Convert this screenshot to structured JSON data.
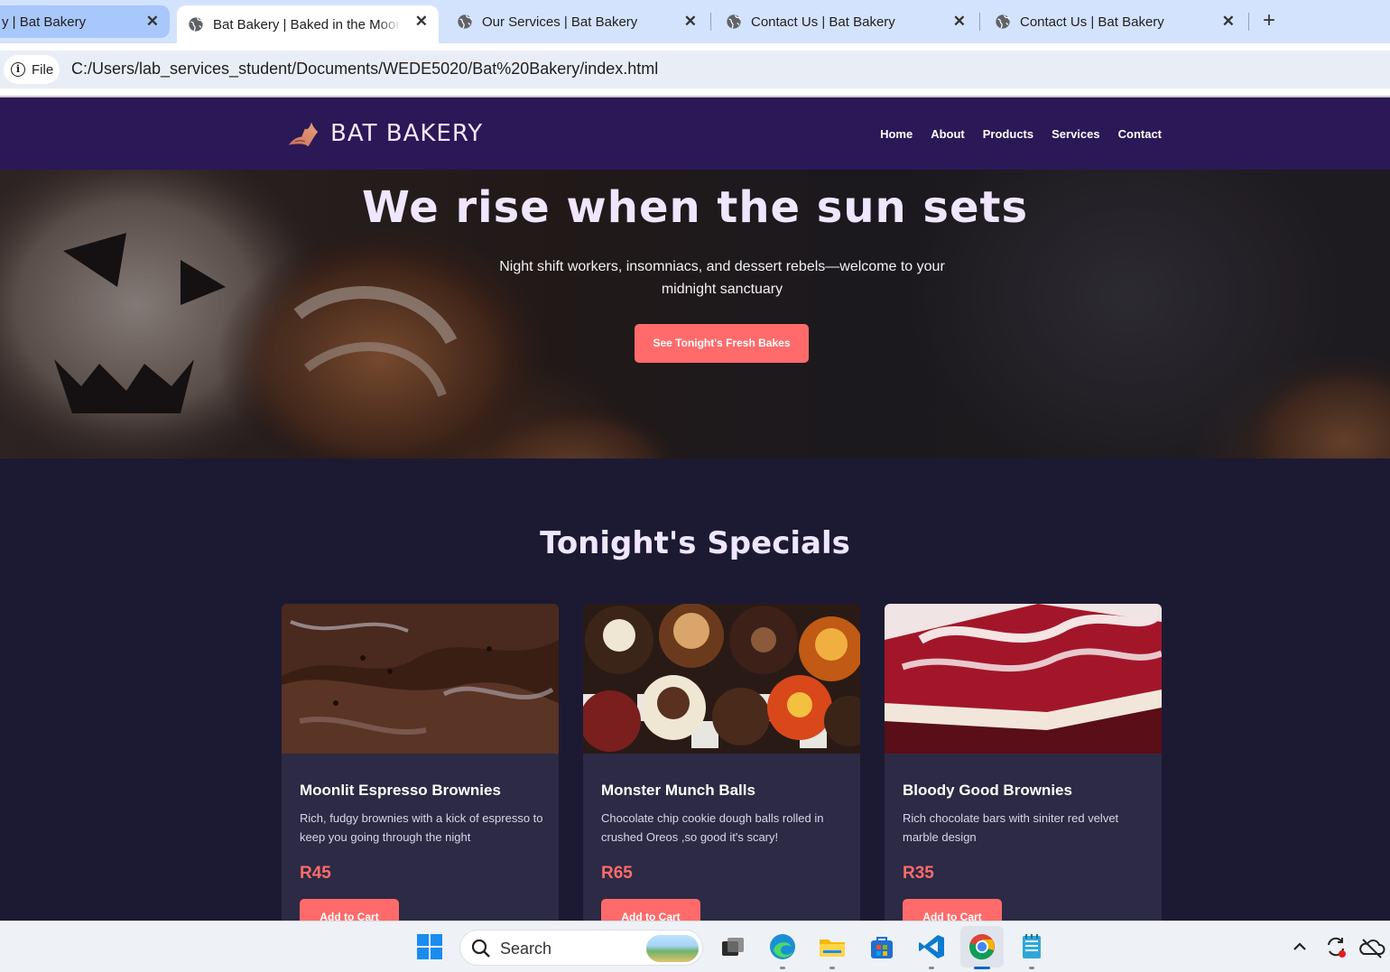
{
  "browser": {
    "tabs": [
      {
        "title": "y | Bat Bakery"
      },
      {
        "title": "Bat Bakery | Baked in the Moonlight",
        "active": true
      },
      {
        "title": "Our Services | Bat Bakery"
      },
      {
        "title": "Contact Us | Bat Bakery"
      },
      {
        "title": "Contact Us | Bat Bakery"
      }
    ],
    "new_tab": "+",
    "close_glyph": "✕",
    "site_chip": "File",
    "url": "C:/Users/lab_services_student/Documents/WEDE5020/Bat%20Bakery/index.html"
  },
  "site": {
    "brand": "BAT BAKERY",
    "nav": [
      "Home",
      "About",
      "Products",
      "Services",
      "Contact"
    ],
    "hero": {
      "title": "We rise when the sun sets",
      "subtitle": "Night shift workers, insomniacs, and dessert rebels—welcome to your midnight sanctuary",
      "cta": "See Tonight's Fresh Bakes"
    },
    "specials_title": "Tonight's Specials",
    "products": [
      {
        "name": "Moonlit Espresso Brownies",
        "description": "Rich, fudgy brownies with a kick of espresso to keep you going through the night",
        "price": "R45",
        "button": "Add to Cart"
      },
      {
        "name": "Monster Munch Balls",
        "description": "Chocolate chip cookie dough balls rolled in crushed Oreos ,so good it's scary!",
        "price": "R65",
        "button": "Add to Cart"
      },
      {
        "name": "Bloody Good Brownies",
        "description": "Rich chocolate bars with siniter red velvet marble design",
        "price": "R35",
        "button": "Add to Cart"
      }
    ]
  },
  "taskbar": {
    "search_placeholder": "Search",
    "apps": [
      "start-icon",
      "search-icon",
      "task-view-icon",
      "edge-icon",
      "file-explorer-icon",
      "store-icon",
      "vscode-icon",
      "chrome-icon",
      "notepad-icon"
    ],
    "tray": [
      "chevron-up-icon",
      "sync-icon",
      "onedrive-icon"
    ]
  },
  "colors": {
    "nav_bg": "#2b1857",
    "page_bg": "#1c1a33",
    "card_bg": "#2c2a44",
    "accent": "#ff6b6b",
    "heading": "#efe6ff"
  }
}
